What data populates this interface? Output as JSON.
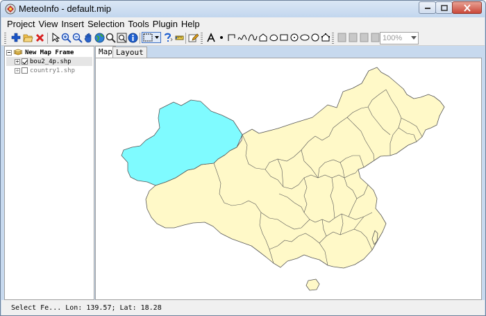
{
  "window": {
    "title": "MeteoInfo - default.mip"
  },
  "menu": [
    "Project",
    "View",
    "Insert",
    "Selection",
    "Tools",
    "Plugin",
    "Help"
  ],
  "toolbar": {
    "zoom": {
      "value": "100%"
    }
  },
  "layers": {
    "frame": "New Map Frame",
    "items": [
      {
        "label": "bou2_4p.shp",
        "checked": true
      },
      {
        "label": "country1.shp",
        "checked": false
      }
    ]
  },
  "tabs": [
    "Map",
    "Layout"
  ],
  "map": {
    "colors": {
      "province_fill": "#fff9c8",
      "selected_fill": "#7ffbff",
      "border": "#555555"
    }
  },
  "status": {
    "mode": "Select Fe...",
    "coords": "Lon: 139.57; Lat: 18.28"
  }
}
